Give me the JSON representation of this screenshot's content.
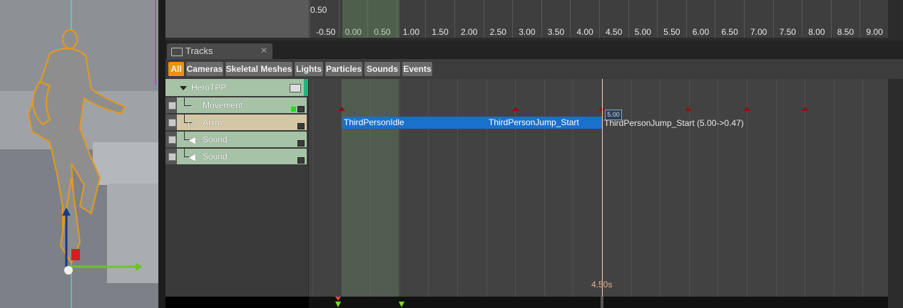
{
  "window": {
    "tab_title": "Tracks",
    "close_glyph": "✕",
    "viewport_icon": "character-mesh"
  },
  "graph": {
    "y_label": "0.50",
    "x_labels": [
      "-0.50",
      "0.00",
      "0.50",
      "1.00",
      "1.50",
      "2.00",
      "2.50",
      "3.00",
      "3.50",
      "4.00",
      "4.50",
      "5.00",
      "5.50",
      "6.00",
      "6.50",
      "7.00",
      "7.50",
      "8.00",
      "8.50",
      "9.00"
    ]
  },
  "filters": [
    {
      "label": "All",
      "active": true
    },
    {
      "label": "Cameras",
      "active": false
    },
    {
      "label": "Skeletal Meshes",
      "active": false
    },
    {
      "label": "Lights",
      "active": false
    },
    {
      "label": "Particles",
      "active": false
    },
    {
      "label": "Sounds",
      "active": false
    },
    {
      "label": "Events",
      "active": false
    }
  ],
  "group": {
    "label": "HeroTPP",
    "expand_icon": "triangle-down-icon",
    "folder_icon": "folder-icon"
  },
  "tracks": [
    {
      "label": "Movement",
      "icon": "movement-icon",
      "color": "#a7c3a7"
    },
    {
      "label": "Anim",
      "icon": "anim-icon",
      "color": "#d4c7a5"
    },
    {
      "label": "Sound",
      "icon": "sound-icon",
      "color": "#a7c3a7"
    },
    {
      "label": "Sound",
      "icon": "sound-icon",
      "color": "#a7c3a7"
    }
  ],
  "clips": [
    {
      "label": "ThirdPersonIdle"
    },
    {
      "label": "ThirdPersonJump_Start"
    }
  ],
  "clip_tail_label": "ThirdPersonJump_Start (5.00->0.47)",
  "playhead": {
    "time_label": "4.50s",
    "box_label": "5.00"
  },
  "colors": {
    "accent": "#e8940e",
    "clip_blue": "#1a70cc",
    "track_green": "#a7c3a7",
    "track_anim": "#d4c7a5",
    "marker_red": "#8b1010"
  }
}
